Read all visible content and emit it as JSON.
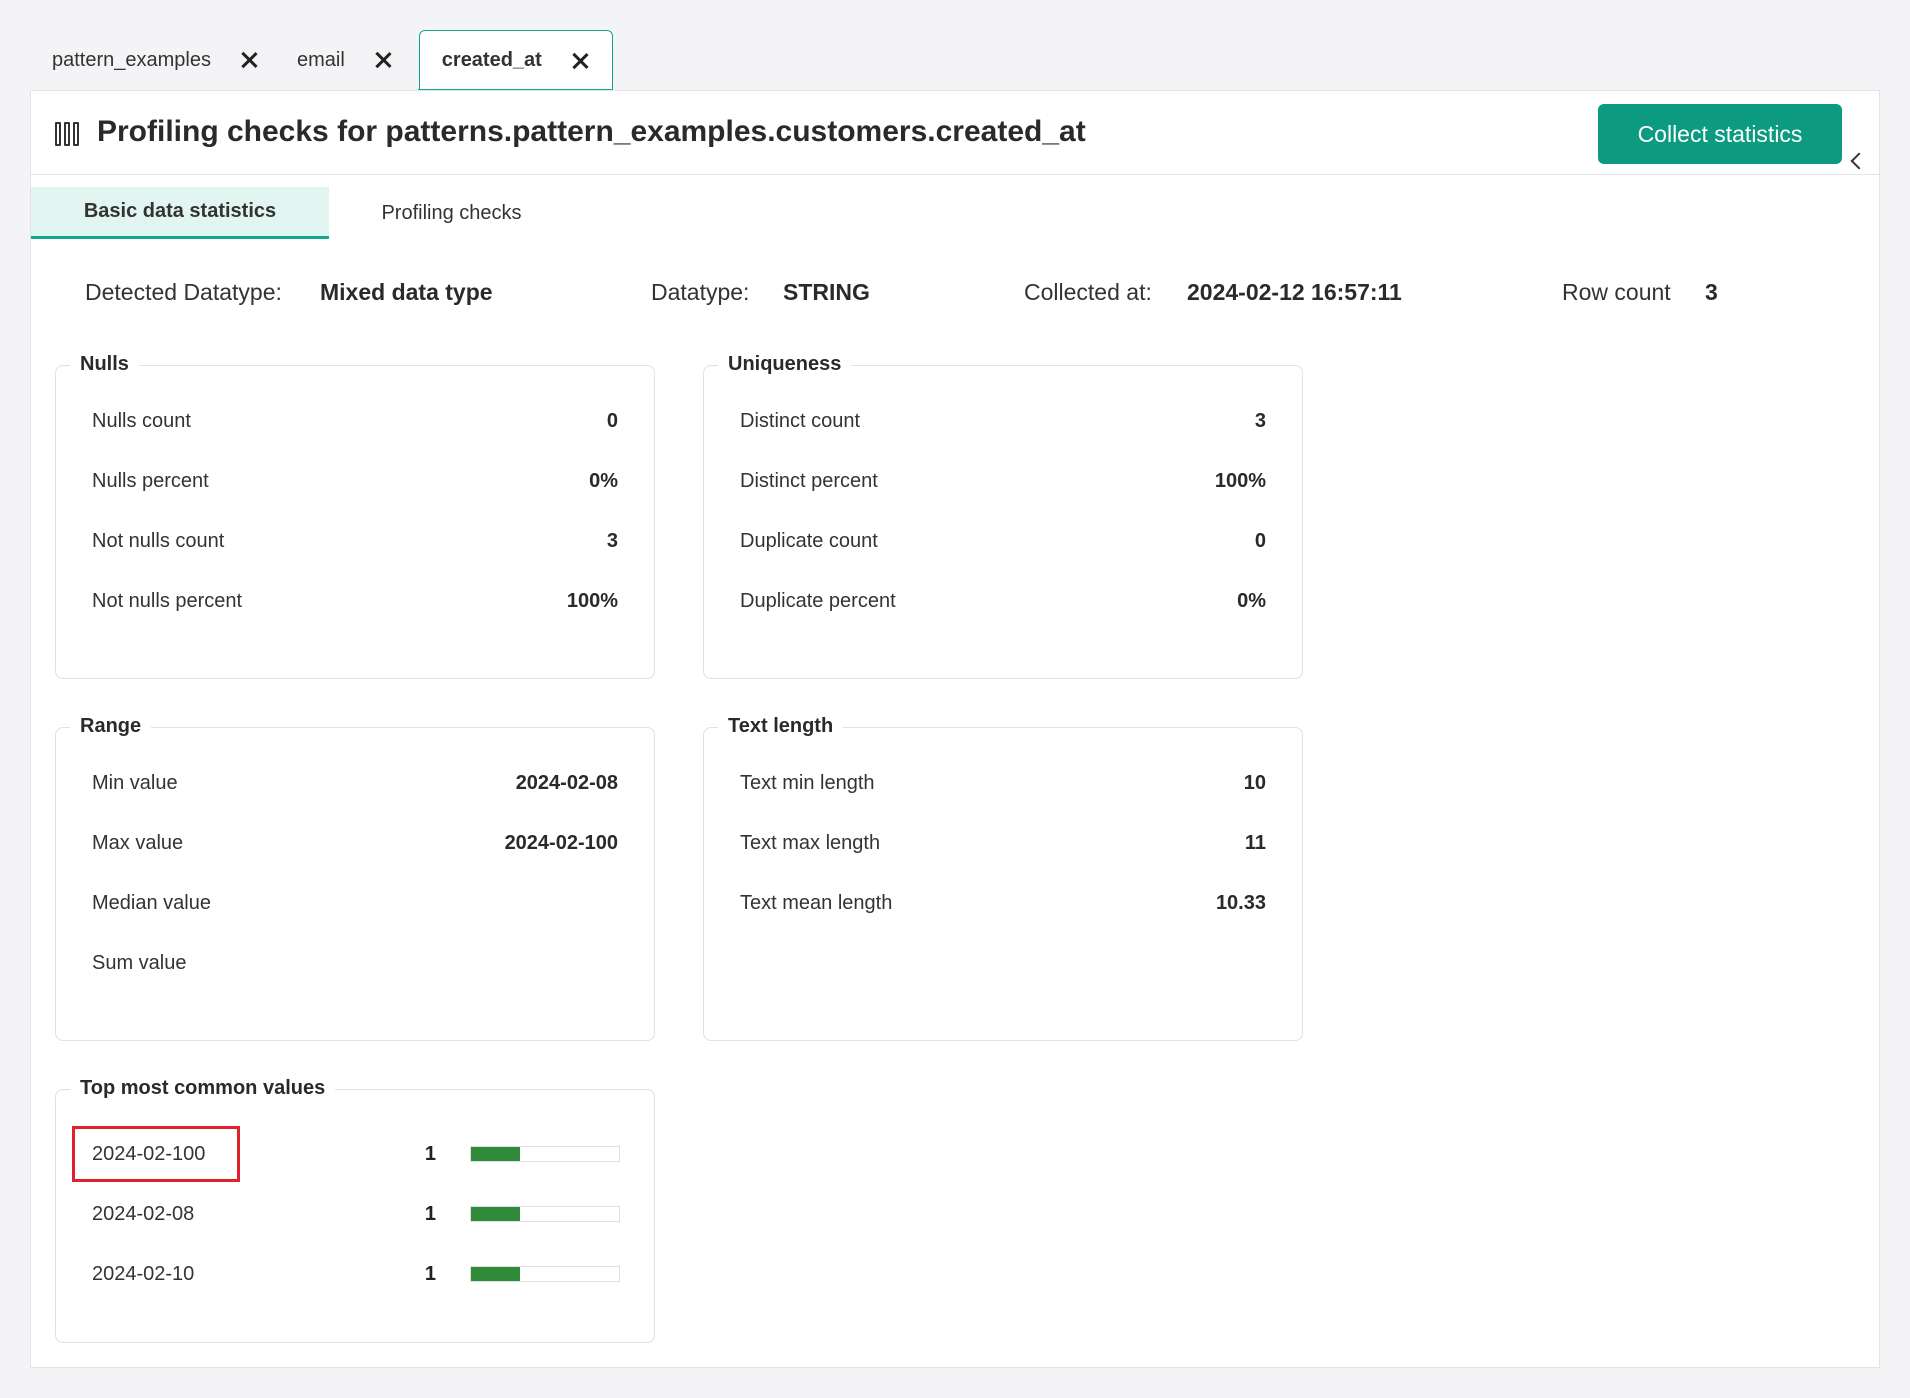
{
  "file_tabs": [
    {
      "label": "pattern_examples"
    },
    {
      "label": "email"
    },
    {
      "label": "created_at"
    }
  ],
  "header": {
    "title": "Profiling checks for patterns.pattern_examples.customers.created_at",
    "collect_button": "Collect statistics"
  },
  "sub_tabs": [
    {
      "label": "Basic data statistics",
      "active": true
    },
    {
      "label": "Profiling checks",
      "active": false
    }
  ],
  "summary": {
    "detected_datatype_label": "Detected Datatype:",
    "detected_datatype_value": "Mixed data type",
    "datatype_label": "Datatype:",
    "datatype_value": "STRING",
    "collected_at_label": "Collected at:",
    "collected_at_value": "2024-02-12 16:57:11",
    "row_count_label": "Row count",
    "row_count_value": "3"
  },
  "nulls": {
    "title": "Nulls",
    "rows": [
      {
        "label": "Nulls count",
        "value": "0"
      },
      {
        "label": "Nulls percent",
        "value": "0%"
      },
      {
        "label": "Not nulls count",
        "value": "3"
      },
      {
        "label": "Not nulls percent",
        "value": "100%"
      }
    ]
  },
  "uniqueness": {
    "title": "Uniqueness",
    "rows": [
      {
        "label": "Distinct count",
        "value": "3"
      },
      {
        "label": "Distinct percent",
        "value": "100%"
      },
      {
        "label": "Duplicate count",
        "value": "0"
      },
      {
        "label": "Duplicate percent",
        "value": "0%"
      }
    ]
  },
  "range": {
    "title": "Range",
    "rows": [
      {
        "label": "Min value",
        "value": "2024-02-08"
      },
      {
        "label": "Max value",
        "value": "2024-02-100"
      },
      {
        "label": "Median value",
        "value": ""
      },
      {
        "label": "Sum value",
        "value": ""
      }
    ]
  },
  "text_length": {
    "title": "Text length",
    "rows": [
      {
        "label": "Text min length",
        "value": "10"
      },
      {
        "label": "Text max length",
        "value": "11"
      },
      {
        "label": "Text mean length",
        "value": "10.33"
      }
    ]
  },
  "top_values": {
    "title": "Top most common values",
    "rows": [
      {
        "label": "2024-02-100",
        "count": "1",
        "fill_fraction": 0.33
      },
      {
        "label": "2024-02-08",
        "count": "1",
        "fill_fraction": 0.33
      },
      {
        "label": "2024-02-10",
        "count": "1",
        "fill_fraction": 0.33
      }
    ]
  },
  "colors": {
    "accent": "#0c9a80",
    "bar_fill": "#2f8a3a",
    "highlight": "#e0202a"
  }
}
